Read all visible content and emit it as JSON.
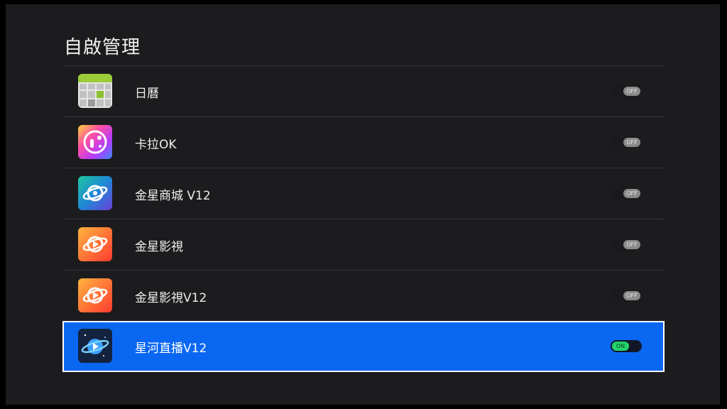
{
  "page": {
    "title": "自啟管理"
  },
  "apps": [
    {
      "label": "日曆",
      "icon": "calendar-icon",
      "toggle": "OFF",
      "enabled": false
    },
    {
      "label": "卡拉OK",
      "icon": "karaoke-icon",
      "toggle": "OFF",
      "enabled": false
    },
    {
      "label": "金星商城 V12",
      "icon": "venus-store-icon",
      "toggle": "OFF",
      "enabled": false
    },
    {
      "label": "金星影視",
      "icon": "venus-video-icon",
      "toggle": "OFF",
      "enabled": false
    },
    {
      "label": "金星影視V12",
      "icon": "venus-video-v12-icon",
      "toggle": "OFF",
      "enabled": false
    },
    {
      "label": "星河直播V12",
      "icon": "galaxy-live-icon",
      "toggle": "ON",
      "enabled": true,
      "selected": true
    }
  ],
  "colors": {
    "background": "#1c1c1e",
    "selected_row": "#0a67f2",
    "toggle_on": "#23d36c",
    "toggle_off": "#8a8a8a"
  }
}
